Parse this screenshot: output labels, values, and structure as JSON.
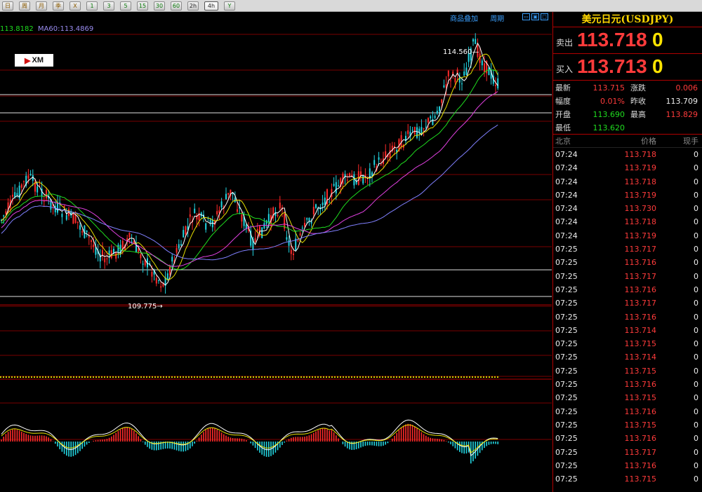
{
  "toolbar": {
    "buttons": [
      {
        "label": "日",
        "tone": "o"
      },
      {
        "label": "周",
        "tone": "o"
      },
      {
        "label": "月",
        "tone": "o"
      },
      {
        "label": "季",
        "tone": "o"
      },
      {
        "label": "X",
        "tone": "o"
      },
      {
        "label": "1",
        "tone": "g"
      },
      {
        "label": "3",
        "tone": "g"
      },
      {
        "label": "5",
        "tone": "g"
      },
      {
        "label": "15",
        "tone": "g"
      },
      {
        "label": "30",
        "tone": "g"
      },
      {
        "label": "60",
        "tone": "g"
      },
      {
        "label": "2h",
        "tone": ""
      },
      {
        "label": "4h",
        "tone": "active"
      },
      {
        "label": "Y",
        "tone": "g"
      }
    ]
  },
  "chart": {
    "ma20_label": "113.8182",
    "ma60_label": "MA60:113.4869",
    "link_overlay": "商品叠加",
    "link_period": "周期",
    "logo_text": "XM",
    "high_label": "114.560",
    "low_label": "109.775",
    "colors": {
      "up": "#ff2a2a",
      "down": "#22d4e0",
      "ma_white": "#ffffff",
      "ma_yellow": "#e8e000",
      "ma_green": "#1fdc1f",
      "ma_magenta": "#e040e0",
      "ma_purple": "#8080ff",
      "grid": "#7a0000"
    }
  },
  "chart_data": {
    "type": "candlestick",
    "high": 114.56,
    "low": 109.775,
    "indicators": [
      "MA",
      "MA60",
      "MACD"
    ]
  },
  "panel": {
    "title": "美元日元(USDJPY)",
    "sell_label": "卖出",
    "sell_price": "113.718",
    "sell_last": "0",
    "buy_label": "买入",
    "buy_price": "113.713",
    "buy_last": "0",
    "stats": [
      {
        "l1": "最新",
        "v1": "113.715",
        "c1": "c-red",
        "l2": "涨跌",
        "v2": "0.006",
        "c2": "c-red"
      },
      {
        "l1": "幅度",
        "v1": "0.01%",
        "c1": "c-red",
        "l2": "昨收",
        "v2": "113.709",
        "c2": "c-white"
      },
      {
        "l1": "开盘",
        "v1": "113.690",
        "c1": "c-green",
        "l2": "最高",
        "v2": "113.829",
        "c2": "c-red"
      },
      {
        "l1": "最低",
        "v1": "113.620",
        "c1": "c-green",
        "l2": "",
        "v2": "",
        "c2": "c-white"
      }
    ],
    "ticks_header": {
      "time": "北京",
      "price": "价格",
      "vol": "现手"
    },
    "ticks": [
      {
        "time": "07:24",
        "price": "113.718",
        "vol": "0"
      },
      {
        "time": "07:24",
        "price": "113.719",
        "vol": "0"
      },
      {
        "time": "07:24",
        "price": "113.718",
        "vol": "0"
      },
      {
        "time": "07:24",
        "price": "113.719",
        "vol": "0"
      },
      {
        "time": "07:24",
        "price": "113.730",
        "vol": "0"
      },
      {
        "time": "07:24",
        "price": "113.718",
        "vol": "0"
      },
      {
        "time": "07:24",
        "price": "113.719",
        "vol": "0"
      },
      {
        "time": "07:25",
        "price": "113.717",
        "vol": "0"
      },
      {
        "time": "07:25",
        "price": "113.716",
        "vol": "0"
      },
      {
        "time": "07:25",
        "price": "113.717",
        "vol": "0"
      },
      {
        "time": "07:25",
        "price": "113.716",
        "vol": "0"
      },
      {
        "time": "07:25",
        "price": "113.717",
        "vol": "0"
      },
      {
        "time": "07:25",
        "price": "113.716",
        "vol": "0"
      },
      {
        "time": "07:25",
        "price": "113.714",
        "vol": "0"
      },
      {
        "time": "07:25",
        "price": "113.715",
        "vol": "0"
      },
      {
        "time": "07:25",
        "price": "113.714",
        "vol": "0"
      },
      {
        "time": "07:25",
        "price": "113.715",
        "vol": "0"
      },
      {
        "time": "07:25",
        "price": "113.716",
        "vol": "0"
      },
      {
        "time": "07:25",
        "price": "113.715",
        "vol": "0"
      },
      {
        "time": "07:25",
        "price": "113.716",
        "vol": "0"
      },
      {
        "time": "07:25",
        "price": "113.715",
        "vol": "0"
      },
      {
        "time": "07:25",
        "price": "113.716",
        "vol": "0"
      },
      {
        "time": "07:25",
        "price": "113.717",
        "vol": "0"
      },
      {
        "time": "07:25",
        "price": "113.716",
        "vol": "0"
      },
      {
        "time": "07:25",
        "price": "113.715",
        "vol": "0"
      }
    ]
  }
}
